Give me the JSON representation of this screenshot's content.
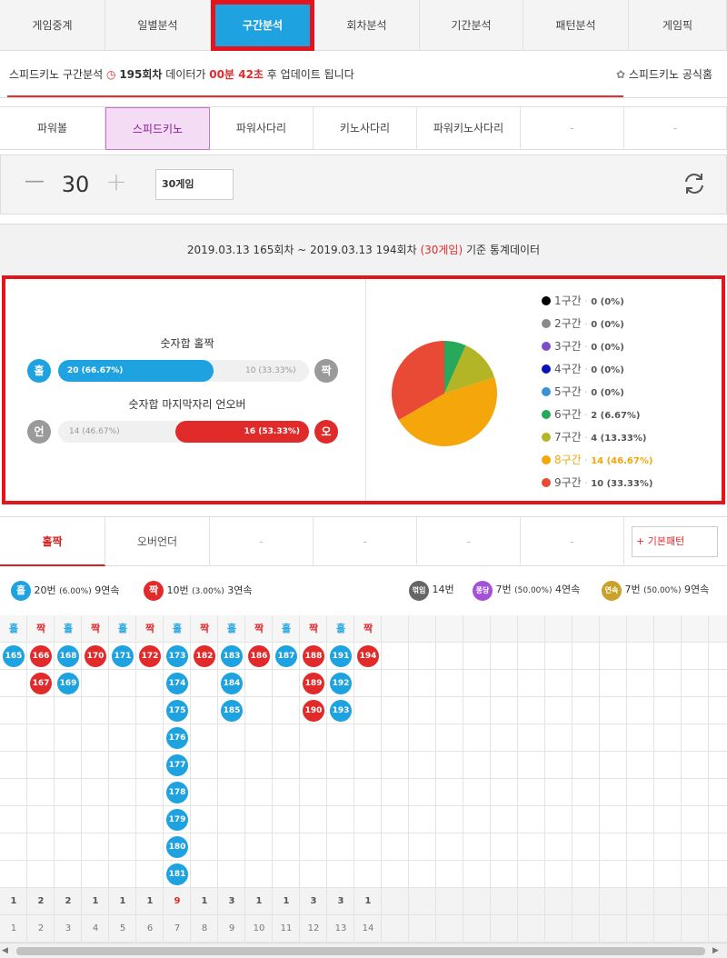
{
  "topnav": {
    "tabs": [
      "게임중계",
      "일별분석",
      "구간분석",
      "회차분석",
      "기간분석",
      "패턴분석",
      "게임픽"
    ],
    "active_index": 2
  },
  "infobar": {
    "prefix": "스피드키노 구간분석",
    "round": "195회차",
    "middle": "데이터가",
    "countdown": "00분 42초",
    "suffix": "후 업데이트 됩니다",
    "official_link": "스피드키노 공식홈"
  },
  "gametabs": {
    "tabs": [
      "파워볼",
      "스피드키노",
      "파워사다리",
      "키노사다리",
      "파워키노사다리",
      "-",
      "-"
    ],
    "active_index": 1
  },
  "countbar": {
    "minus": "—",
    "count": "30",
    "plus": "+",
    "select_value": "30게임",
    "refresh_icon": "refresh-icon"
  },
  "daterange": {
    "text_before": "2019.03.13 165회차 ~ 2019.03.13 194회차",
    "highlight": "(30게임)",
    "text_after": "기준 통계데이터"
  },
  "stats": {
    "oddeven": {
      "title": "숫자합 홀짝",
      "left_badge": "홀",
      "right_badge": "짝",
      "left_label": "20 (66.67%)",
      "right_label": "10 (33.33%)",
      "left_fraction": 0.6667
    },
    "underover": {
      "title": "숫자합 마지막자리 언오버",
      "left_badge": "언",
      "right_badge": "오",
      "left_label": "14 (46.67%)",
      "right_label": "16 (53.33%)",
      "right_fraction": 0.5333
    },
    "colors": {
      "blue": "#1ea2e0",
      "red": "#e12a2a",
      "gray": "#9a9a9a"
    }
  },
  "chart_data": {
    "type": "pie",
    "categories": [
      "1구간",
      "2구간",
      "3구간",
      "4구간",
      "5구간",
      "6구간",
      "7구간",
      "8구간",
      "9구간"
    ],
    "values": [
      0,
      0,
      0,
      0,
      0,
      2,
      4,
      14,
      10
    ],
    "value_labels": [
      "0 (0%)",
      "0 (0%)",
      "0 (0%)",
      "0 (0%)",
      "0 (0%)",
      "2 (6.67%)",
      "4 (13.33%)",
      "14 (46.67%)",
      "10 (33.33%)"
    ],
    "colors": [
      "#000000",
      "#8a8a8a",
      "#7b4fc9",
      "#0a12b5",
      "#3a92d6",
      "#27a85a",
      "#b3b526",
      "#f4a60a",
      "#e84a35"
    ],
    "highlight_index": 7,
    "legend": "right"
  },
  "pattabs": {
    "tabs": [
      "홀짝",
      "오버언더",
      "-",
      "-",
      "-",
      "-"
    ],
    "active_index": 0,
    "basic_pattern": "+ 기본패턴"
  },
  "summary": {
    "odd": {
      "badge": "홀",
      "text": "20번",
      "pct": "(6.00%)",
      "streak": "9연속"
    },
    "even": {
      "badge": "짝",
      "text": "10번",
      "pct": "(3.00%)",
      "streak": "3연속"
    },
    "break": {
      "badge": "꺾임",
      "text": "14번"
    },
    "pong": {
      "badge": "퐁당",
      "text": "7번",
      "pct": "(50.00%)",
      "streak": "4연속"
    },
    "run": {
      "badge": "연속",
      "text": "7번",
      "pct": "(50.00%)",
      "streak": "9연속"
    }
  },
  "grid": {
    "columns": [
      {
        "head": "홀",
        "kind": "odd",
        "rounds": [
          "165"
        ]
      },
      {
        "head": "짝",
        "kind": "even",
        "rounds": [
          "166",
          "167"
        ]
      },
      {
        "head": "홀",
        "kind": "odd",
        "rounds": [
          "168",
          "169"
        ]
      },
      {
        "head": "짝",
        "kind": "even",
        "rounds": [
          "170"
        ]
      },
      {
        "head": "홀",
        "kind": "odd",
        "rounds": [
          "171"
        ]
      },
      {
        "head": "짝",
        "kind": "even",
        "rounds": [
          "172"
        ]
      },
      {
        "head": "홀",
        "kind": "odd",
        "rounds": [
          "173",
          "174",
          "175",
          "176",
          "177",
          "178",
          "179",
          "180",
          "181"
        ]
      },
      {
        "head": "짝",
        "kind": "even",
        "rounds": [
          "182"
        ]
      },
      {
        "head": "홀",
        "kind": "odd",
        "rounds": [
          "183",
          "184",
          "185"
        ]
      },
      {
        "head": "짝",
        "kind": "even",
        "rounds": [
          "186"
        ]
      },
      {
        "head": "홀",
        "kind": "odd",
        "rounds": [
          "187"
        ]
      },
      {
        "head": "짝",
        "kind": "even",
        "rounds": [
          "188",
          "189",
          "190"
        ]
      },
      {
        "head": "홀",
        "kind": "odd",
        "rounds": [
          "191",
          "192",
          "193"
        ]
      },
      {
        "head": "짝",
        "kind": "even",
        "rounds": [
          "194"
        ]
      }
    ],
    "counts": [
      "1",
      "2",
      "2",
      "1",
      "1",
      "1",
      "9",
      "1",
      "3",
      "1",
      "1",
      "3",
      "3",
      "1"
    ],
    "max_count_index": 6,
    "indexes": [
      "1",
      "2",
      "3",
      "4",
      "5",
      "6",
      "7",
      "8",
      "9",
      "10",
      "11",
      "12",
      "13",
      "14"
    ]
  }
}
